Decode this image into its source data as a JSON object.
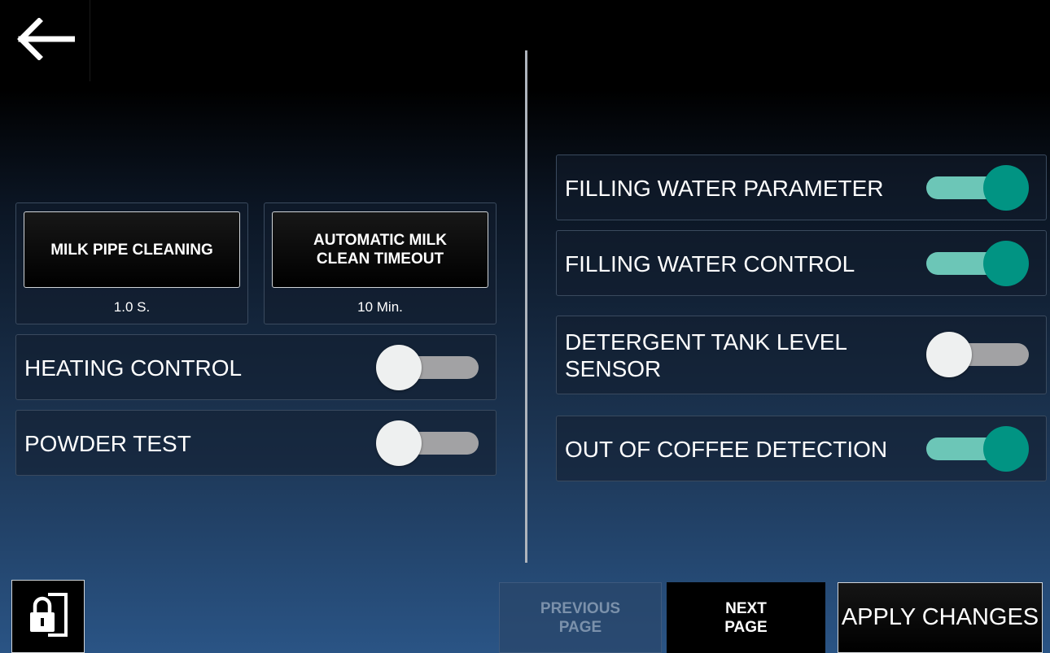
{
  "header": {
    "back_icon": "arrow-left-icon"
  },
  "left": {
    "milk_pipe": {
      "button_label": "MILK PIPE CLEANING",
      "value": "1.0 S."
    },
    "auto_milk": {
      "button_label": "AUTOMATIC MILK\nCLEAN TIMEOUT",
      "value": "10 Min."
    },
    "heating": {
      "label": "HEATING CONTROL",
      "enabled": false
    },
    "powder": {
      "label": "POWDER TEST",
      "enabled": false
    }
  },
  "right": {
    "filling_param": {
      "label": "FILLING WATER PARAMETER",
      "enabled": true
    },
    "filling_control": {
      "label": "FILLING WATER CONTROL",
      "enabled": true
    },
    "detergent": {
      "label": "DETERGENT TANK LEVEL\nSENSOR",
      "enabled": false
    },
    "coffee_detection": {
      "label": "OUT OF COFFEE DETECTION",
      "enabled": true
    }
  },
  "footer": {
    "lock_icon": "lock-door-icon",
    "previous_label": "PREVIOUS\nPAGE",
    "next_label": "NEXT\nPAGE",
    "apply_label": "APPLY CHANGES"
  },
  "colors": {
    "toggle_on_knob": "#019483",
    "toggle_on_track": "#6cc6b7",
    "toggle_off_knob": "#eef0f0",
    "toggle_off_track": "#a2a2a4"
  }
}
